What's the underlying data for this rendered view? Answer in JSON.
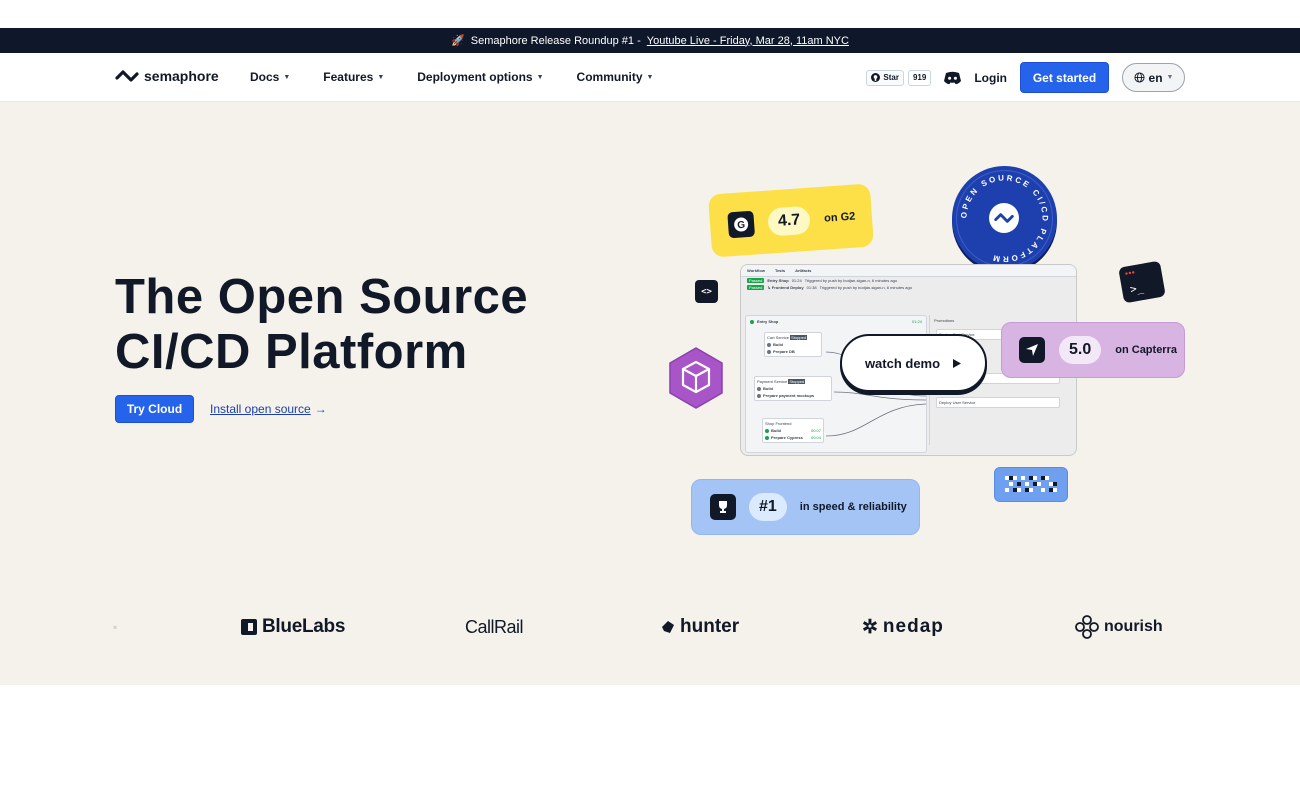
{
  "announcement": {
    "emoji": "🚀",
    "text": "Semaphore Release Roundup #1 -",
    "link": "Youtube Live - Friday, Mar 28, 11am NYC"
  },
  "nav": {
    "logo_text": "semaphore",
    "menu": [
      {
        "label": "Docs"
      },
      {
        "label": "Features"
      },
      {
        "label": "Deployment options"
      },
      {
        "label": "Community"
      }
    ],
    "github_star_label": "Star",
    "github_star_count": "919",
    "login_label": "Login",
    "get_started_label": "Get started",
    "language": "en"
  },
  "hero": {
    "title_line1": "The Open Source",
    "title_line2": "CI/CD Platform",
    "try_cloud_label": "Try Cloud",
    "install_label": "Install open source",
    "g2": {
      "rating": "4.7",
      "label": "on G2"
    },
    "stamp_text": "OPEN SOURCE CI/CD PLATFORM",
    "capterra": {
      "rating": "5.0",
      "label": "on Capterra"
    },
    "rank": {
      "value": "#1",
      "label": "in speed & reliability"
    },
    "watch_demo_label": "watch demo",
    "workflow": {
      "tabs": [
        "Workflow",
        "Tests",
        "Artifacts"
      ],
      "runs": [
        {
          "tag": "Passed",
          "name": "Entry Shop",
          "time": "01:24",
          "note": "Triggered by push by bodjan-sigan-n, 6 minutes ago"
        },
        {
          "tag": "Passed",
          "name": "↳ Frontend Deploy",
          "time": "01:38",
          "note": "Triggered by push by bodjan-sigan-n, 6 minutes ago"
        }
      ],
      "pipeline_name": "Entry Shop",
      "pipeline_time": "01:24",
      "blocks": [
        {
          "title": "Cart Service",
          "badge": "Stopped",
          "jobs": [
            "Build",
            "Prepare DB"
          ]
        },
        {
          "title": "Payment Service",
          "badge": "Stopped",
          "jobs": [
            "Build",
            "Prepare payment mockups"
          ]
        },
        {
          "title": "Shop Frontend",
          "badge": "",
          "jobs": [
            "Build",
            "Prepare Cypress"
          ],
          "times": [
            "00:07",
            "00:04"
          ]
        }
      ],
      "promotions_label": "Promotions",
      "promotions": [
        "Deploy Cart Service",
        "Deploy Auth Service",
        "Deploy User Service"
      ]
    }
  },
  "customers": [
    "BlueLabs",
    "CallRail",
    "hunter",
    "nedap",
    "nourish"
  ],
  "colors": {
    "accent": "#2563eb",
    "announce_bg": "#0f172a",
    "hero_bg": "#f5f2eb",
    "g2_card": "#fde047",
    "capterra_card": "#d8b4e2",
    "rank_card": "#a3c4f5",
    "stamp": "#1e40af",
    "cube": "#a855c7"
  }
}
